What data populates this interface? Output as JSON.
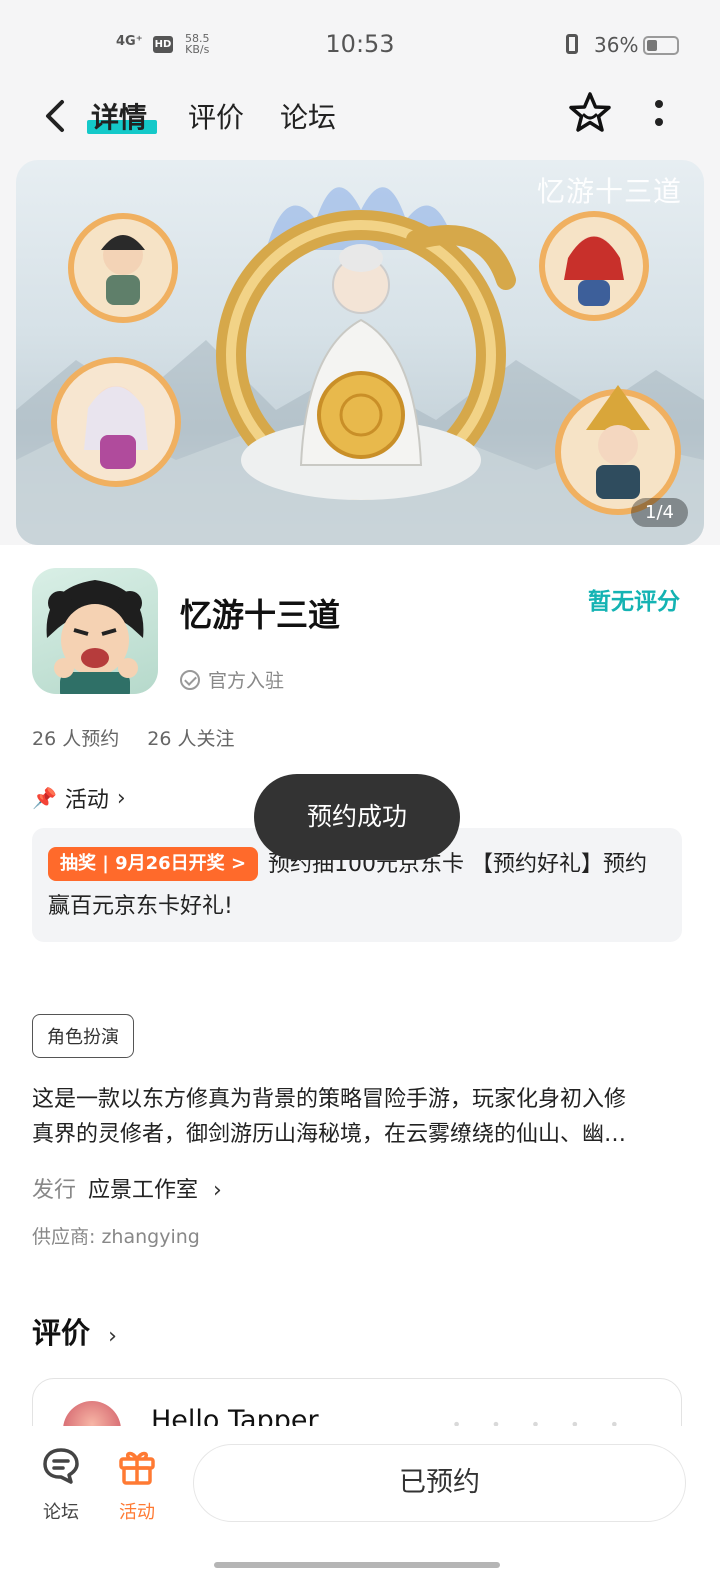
{
  "status_bar": {
    "network": "4G⁺",
    "hd": "HD",
    "speed_value": "58.5",
    "speed_unit": "KB/s",
    "time": "10:53",
    "battery_pct": "36%",
    "battery_level": 0.36
  },
  "nav": {
    "tabs": [
      {
        "label": "详情",
        "active": true
      },
      {
        "label": "评价",
        "active": false
      },
      {
        "label": "论坛",
        "active": false
      }
    ]
  },
  "banner": {
    "title": "忆游十三道",
    "pager": "1/4"
  },
  "game": {
    "name": "忆游十三道",
    "rating": "暂无评分",
    "official": "官方入驻",
    "reservations": "26 人预约",
    "followers": "26 人关注"
  },
  "activity": {
    "header": "活动",
    "tag": "抽奖 | 9月26日开奖 >",
    "text": "预约抽100元京东卡 【预约好礼】预约赢百元京东卡好礼!"
  },
  "toast": "预约成功",
  "details": {
    "genre": "角色扮演",
    "description_line1": "这是一款以东方修真为背景的策略冒险手游，玩家化身初入修",
    "description_line2": "真界的灵修者，御剑游历山海秘境，在云雾缭绕的仙山、幽…",
    "publisher_label": "发行",
    "publisher": "应景工作室",
    "supplier": "供应商: zhangying"
  },
  "reviews": {
    "header": "评价",
    "user": "Hello Tapper"
  },
  "bottom_bar": {
    "forum_label": "论坛",
    "activity_label": "活动",
    "reserved_label": "已预约"
  },
  "colors": {
    "accent": "#14c9c9",
    "orange": "#ff6a2b",
    "toast_bg": "#333333"
  }
}
